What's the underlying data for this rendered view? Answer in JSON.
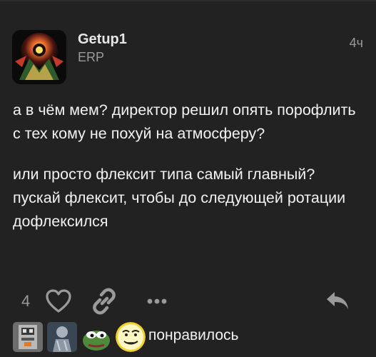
{
  "post": {
    "username": "Getup1",
    "user_title": "ERP",
    "date": "4ч",
    "paragraphs": [
      "а в чём мем? директор решил опять порофлить с тех кому не похуй на атмосферу?",
      "или просто флексит типа самый главный? пускай флексит, чтобы до следующей ротации дофлексился"
    ]
  },
  "actions": {
    "like_count": "4",
    "like_icon": "heart-icon",
    "link_icon": "link-icon",
    "more_icon": "ellipsis-icon",
    "reply_icon": "reply-icon"
  },
  "likers": {
    "label": "понравилось",
    "avatars": [
      "avatar-robot",
      "avatar-statue",
      "avatar-pepe",
      "avatar-meme-face"
    ]
  },
  "colors": {
    "background": "#222222",
    "text": "#f2f2f2",
    "muted": "#9a9a9a"
  }
}
